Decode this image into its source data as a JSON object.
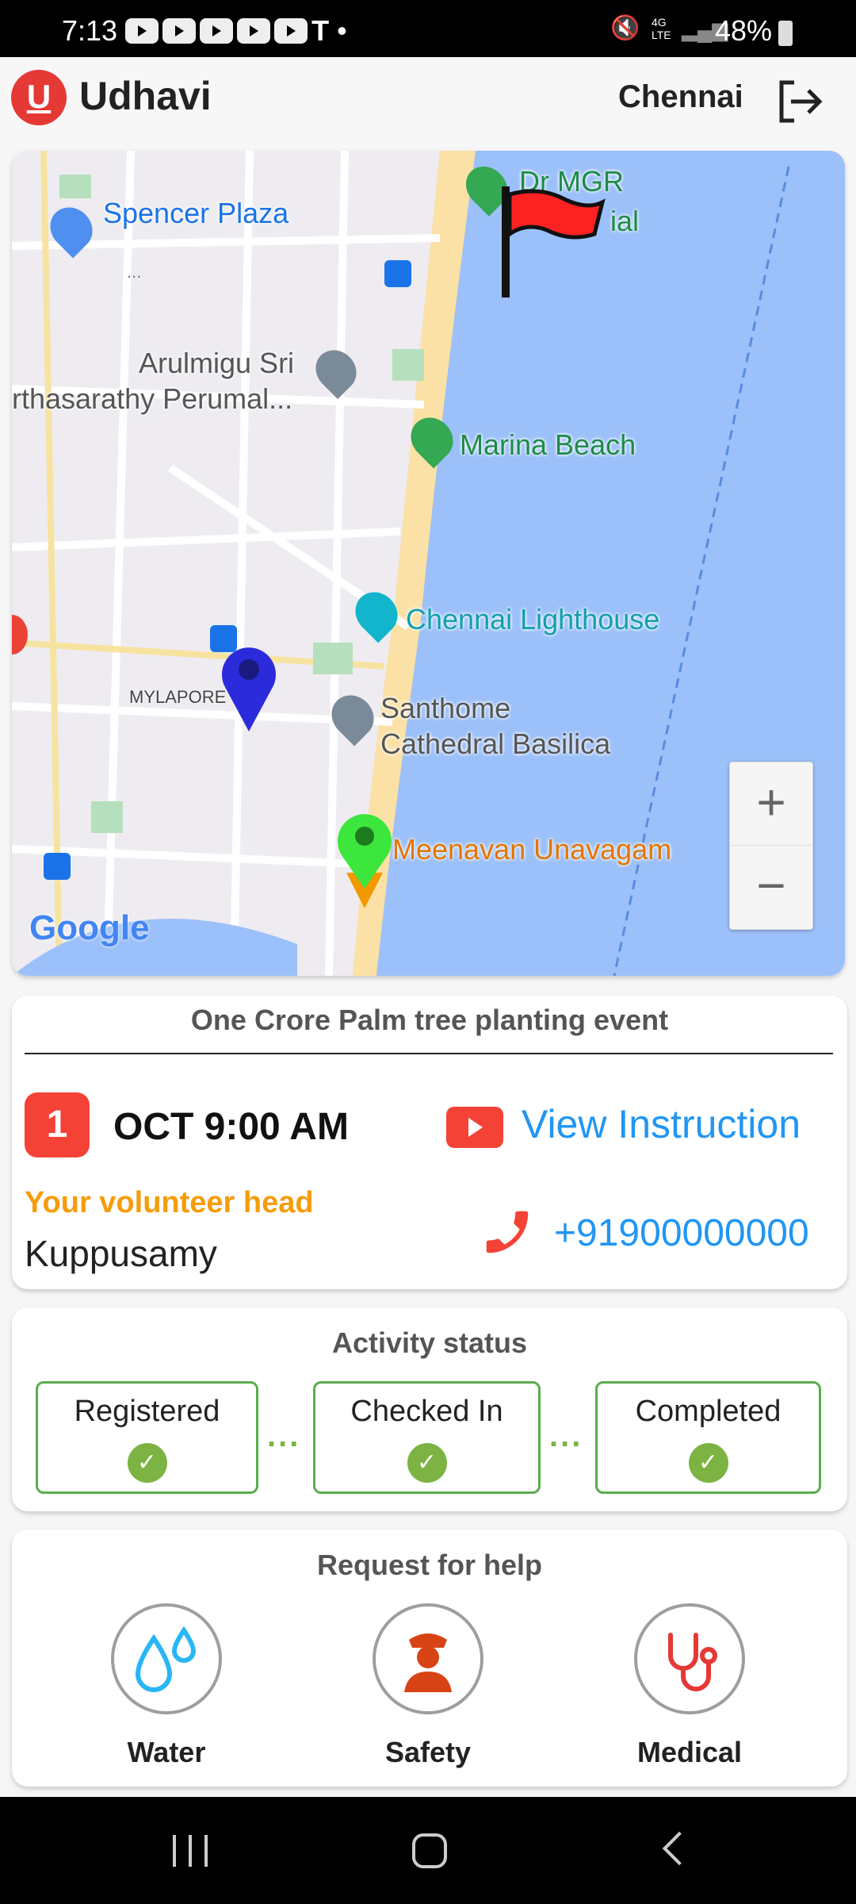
{
  "status_bar": {
    "time": "7:13",
    "battery": "48%",
    "network": "4G LTE",
    "carrier_icon": "T"
  },
  "header": {
    "app_name": "Udhavi",
    "logo_letter": "U",
    "city": "Chennai",
    "logout_icon": "logout-icon"
  },
  "map": {
    "labels": {
      "spencer": "Spencer Plaza",
      "mgr": "Dr MGR",
      "mgr2": "ial",
      "temple1": "Arulmigu Sri",
      "temple2": "rthasarathy Perumal...",
      "marina": "Marina Beach",
      "lighthouse": "Chennai Lighthouse",
      "mylapore": "MYLAPORE",
      "santhome1": "Santhome",
      "santhome2": "Cathedral Basilica",
      "meenavan": "Meenavan Unavagam",
      "ellipsis": "..."
    },
    "google": "Google",
    "zoom_in": "+",
    "zoom_out": "−"
  },
  "event": {
    "title": "One Crore Palm tree planting event",
    "day": "1",
    "date_time": "OCT 9:00 AM",
    "view_instruction": "View Instruction",
    "volunteer_label": "Your volunteer head",
    "volunteer_name": "Kuppusamy",
    "phone": "+91900000000"
  },
  "activity": {
    "title": "Activity status",
    "steps": [
      {
        "label": "Registered",
        "done": true
      },
      {
        "label": "Checked In",
        "done": true
      },
      {
        "label": "Completed",
        "done": true
      }
    ],
    "connector": "..."
  },
  "help": {
    "title": "Request for help",
    "items": [
      {
        "label": "Water",
        "icon": "water-drops-icon"
      },
      {
        "label": "Safety",
        "icon": "police-officer-icon"
      },
      {
        "label": "Medical",
        "icon": "stethoscope-icon"
      }
    ]
  },
  "colors": {
    "brand": "#e53935",
    "link": "#2196f3",
    "orange": "#f59c0b",
    "green": "#7cb342"
  }
}
